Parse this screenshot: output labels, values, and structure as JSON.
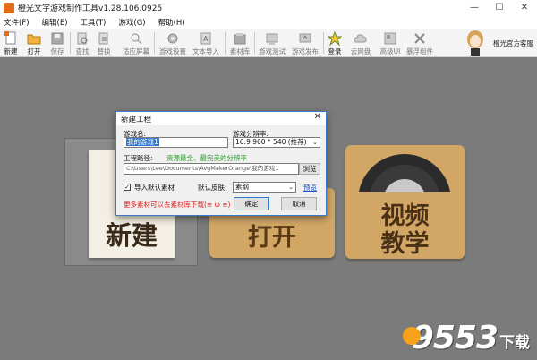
{
  "window": {
    "title": "橙光文字游戏制作工具v1.28.106.0925",
    "min": "—",
    "max": "☐",
    "close": "✕"
  },
  "menu": [
    {
      "label": "文件(F)"
    },
    {
      "label": "编辑(E)"
    },
    {
      "label": "工具(T)"
    },
    {
      "label": "游戏(G)"
    },
    {
      "label": "帮助(H)"
    }
  ],
  "toolbar": [
    {
      "label": "新建",
      "icon": "new-file-icon"
    },
    {
      "label": "打开",
      "icon": "folder-icon"
    },
    {
      "label": "保存",
      "icon": "save-icon"
    },
    {
      "label": "查找",
      "icon": "find-icon"
    },
    {
      "label": "替换",
      "icon": "replace-icon"
    },
    {
      "label": "适应屏幕",
      "icon": "fit-screen-icon"
    },
    {
      "label": "游戏设置",
      "icon": "gear-icon"
    },
    {
      "label": "文本导入",
      "icon": "text-import-icon"
    },
    {
      "label": "素材库",
      "icon": "library-icon"
    },
    {
      "label": "游戏测试",
      "icon": "test-icon"
    },
    {
      "label": "游戏发布",
      "icon": "publish-icon"
    },
    {
      "label": "登录",
      "icon": "login-icon"
    },
    {
      "label": "云网盘",
      "icon": "cloud-icon"
    },
    {
      "label": "高级UI",
      "icon": "advanced-ui-icon"
    },
    {
      "label": "暴浮组件",
      "icon": "plugin-icon"
    }
  ],
  "customer_service": "橙光官方客服",
  "tiles": {
    "new": "新建",
    "open": "打开",
    "video_line1": "视频",
    "video_line2": "教学"
  },
  "dialog": {
    "title": "新建工程",
    "close": "✕",
    "name_label": "游戏名:",
    "name_value": "我的游戏1",
    "resolution_label": "游戏分辨率:",
    "resolution_value": "16:9  960 * 540 (推荐)",
    "path_label": "工程路径:",
    "path_hint": "资源最全、最完美的分辨率",
    "path_value": "C:\\Users\\Lee\\Documents\\AvgMakerOrange\\我的游戏1",
    "browse": "浏览",
    "import_label": "导入默认素材",
    "import_checked": "✓",
    "skin_label": "默认皮肤:",
    "skin_value": "素纲",
    "preview": "预览",
    "more_hint": "更多素材可以去素材库下载(≡ ω ≡)",
    "ok": "确定",
    "cancel": "取消"
  },
  "watermark": {
    "number": "9553",
    "suffix": "下载"
  }
}
